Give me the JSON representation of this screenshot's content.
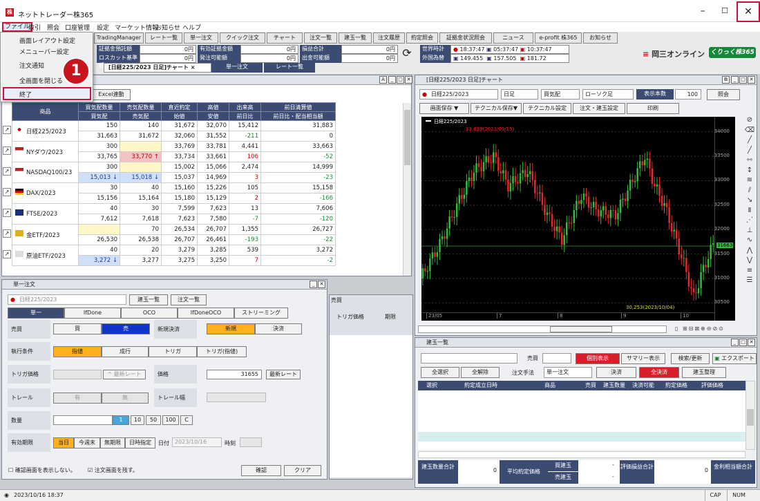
{
  "window": {
    "title": "ネットトレーダー株365",
    "min": "–",
    "max": "☐",
    "close": "✕"
  },
  "menu": [
    "ファイル",
    "取引",
    "照会",
    "口座管理",
    "設定",
    "マーケット情報",
    "お知らせ",
    "ヘルプ"
  ],
  "file_menu": {
    "items": [
      "画面レイアウト設定",
      "メニューバー設定",
      "注文通知",
      "全画面を閉じる",
      "終了"
    ],
    "step": "1"
  },
  "toolbar": [
    "TradingManager",
    "レート一覧",
    "単一注文",
    "クイック注文",
    "チャート",
    "注文一覧",
    "建玉一覧",
    "注文履歴",
    "約定照会",
    "証拠金状況照会",
    "ニュース",
    "e-profit 株365",
    "お知らせ"
  ],
  "account": {
    "labels": [
      "証拠金預託額",
      "ロスカット基準額",
      "有効証拠金額",
      "発注可能額",
      "損益合計",
      "出金可能額"
    ],
    "values": [
      "0円",
      "0円",
      "0円",
      "0円",
      "0円",
      "0円"
    ]
  },
  "world_time": {
    "label": "世界時計",
    "fx_label": "外国為替",
    "times": [
      "18:37:47",
      "05:37:47",
      "10:37:47"
    ],
    "fx": [
      "149.455",
      "157.505",
      "181.72"
    ]
  },
  "brand": "岡三オンライン",
  "brand_badge": "くりっく株365",
  "tabs": [
    "[日経225/2023 日足]チャート ×",
    "単一注文",
    "レート一覧"
  ],
  "excel_btn": "Excel連動",
  "rate_table": {
    "headers1": [
      "商品",
      "買気配数量",
      "売気配数量",
      "直近約定",
      "高値",
      "出来高",
      "前日清算値"
    ],
    "headers2": [
      "",
      "買気配",
      "売気配",
      "始値",
      "安値",
      "前日比",
      "前日比・配当相当額"
    ],
    "rows": [
      {
        "name": "日経225/2023",
        "bq": "150",
        "sq": "140",
        "last": "31,672",
        "high": "32,070",
        "vol": "15,412",
        "prev": "31,883",
        "bid": "31,663",
        "ask": "31,672",
        "open": "32,060",
        "low": "31,552",
        "chg": "-211",
        "div": "0"
      },
      {
        "name": "NYダウ/2023",
        "bq": "300",
        "sq": "",
        "last": "33,769",
        "high": "33,781",
        "vol": "4,441",
        "prev": "33,663",
        "bid": "33,765",
        "ask": "33,770 ↑",
        "open": "33,734",
        "low": "33,661",
        "chg": "106",
        "div": "-52"
      },
      {
        "name": "NASDAQ100/23",
        "bq": "300",
        "sq": "",
        "last": "15,002",
        "high": "15,066",
        "vol": "2,474",
        "prev": "14,999",
        "bid": "15,013 ↓",
        "ask": "15,018 ↓",
        "open": "15,037",
        "low": "14,969",
        "chg": "3",
        "div": "-23"
      },
      {
        "name": "DAX/2023",
        "bq": "30",
        "sq": "40",
        "last": "15,160",
        "high": "15,226",
        "vol": "105",
        "prev": "15,158",
        "bid": "15,156",
        "ask": "15,164",
        "open": "15,180",
        "low": "15,129",
        "chg": "2",
        "div": "-166"
      },
      {
        "name": "FTSE/2023",
        "bq": "40",
        "sq": "30",
        "last": "7,599",
        "high": "7,623",
        "vol": "13",
        "prev": "7,606",
        "bid": "7,612",
        "ask": "7,618",
        "open": "7,623",
        "low": "7,580",
        "chg": "-7",
        "div": "-120"
      },
      {
        "name": "金ETF/2023",
        "bq": "",
        "sq": "70",
        "last": "26,534",
        "high": "26,707",
        "vol": "1,355",
        "prev": "26,727",
        "bid": "26,530",
        "ask": "26,538",
        "open": "26,707",
        "low": "26,461",
        "chg": "-193",
        "div": "-22"
      },
      {
        "name": "原油ETF/2023",
        "bq": "40",
        "sq": "20",
        "last": "3,279",
        "high": "3,285",
        "vol": "539",
        "prev": "3,272",
        "bid": "3,272 ↓",
        "ask": "3,277",
        "open": "3,275",
        "low": "3,250",
        "chg": "7",
        "div": "-2"
      }
    ]
  },
  "order": {
    "title": "単一注文",
    "product": "日経225/2023",
    "pos_btn": "建玉一覧",
    "ord_btn": "注文一覧",
    "tabs": [
      "単一",
      "IfDone",
      "OCO",
      "IfDoneOCO",
      "ストリーミング"
    ],
    "side_label": "売買",
    "buy": "買",
    "sell": "売",
    "new_close_label": "新規決済",
    "new": "新規",
    "close": "決済",
    "exec_label": "執行条件",
    "exec": [
      "指値",
      "成行",
      "トリガ",
      "トリガ(指値)"
    ],
    "trigger_label": "トリガ価格",
    "latest": "最新レート",
    "price_label": "価格",
    "price": "31655",
    "trail_label": "トレール",
    "trail_yes": "有",
    "trail_no": "無",
    "trail_w": "トレール幅",
    "qty_label": "数量",
    "qty_btns": [
      "1",
      "10",
      "50",
      "100",
      "C"
    ],
    "valid_label": "有効期限",
    "valid": [
      "当日",
      "今週末",
      "無期限",
      "日時指定"
    ],
    "date_label": "日付",
    "date": "2023/10/16",
    "time_label": "時刻",
    "chk1": "確認画面を表示しない。",
    "chk2": "注文画面を残す。",
    "confirm": "確認",
    "clear": "クリア"
  },
  "chart": {
    "title": "[日経225/2023 日足]チャート",
    "product": "日経225/2023",
    "period": "日足",
    "side": "買気配",
    "type": "ローソク足",
    "count_label": "表示本数",
    "count": "100",
    "query": "照会",
    "buttons": [
      "画面保存 ▼",
      "テクニカル保存▼",
      "テクニカル設定",
      "注文・建玉設定",
      "印刷"
    ],
    "legend": "日経225/2023",
    "high_note": "33,839(2023/09/15)",
    "low_note": "30,253(2023/10/04)",
    "last": "31663",
    "y_ticks": [
      "34000",
      "33500",
      "33000",
      "32500",
      "32000",
      "31500",
      "31000",
      "30500"
    ],
    "x_ticks": [
      "23/05",
      "7",
      "8",
      "9",
      "10"
    ],
    "colors": {
      "up": "#2fbf3a",
      "down": "#e8262b"
    }
  },
  "positions": {
    "title": "建玉一覧",
    "side": "売買",
    "individual": "個別表示",
    "summary": "サマリー表示",
    "search": "検索/更新",
    "excel": "エクスポート",
    "buttons": [
      "全選択",
      "全解除",
      "注文手法",
      "単一注文",
      "決済",
      "全決済",
      "建玉整理"
    ],
    "headers": [
      "選択",
      "約定成立日時",
      "商品",
      "売買",
      "建玉数量",
      "決済可能",
      "約定価格",
      "評価価格"
    ],
    "footer": [
      "建玉数量合計",
      "0",
      "平均約定価格",
      "買建玉",
      "売建玉",
      "-",
      "-",
      "評価損益合計",
      "0",
      "金利相当額合計"
    ]
  },
  "status": {
    "datetime": "2023/10/16 18:37",
    "cap": "CAP",
    "num": "NUM"
  }
}
